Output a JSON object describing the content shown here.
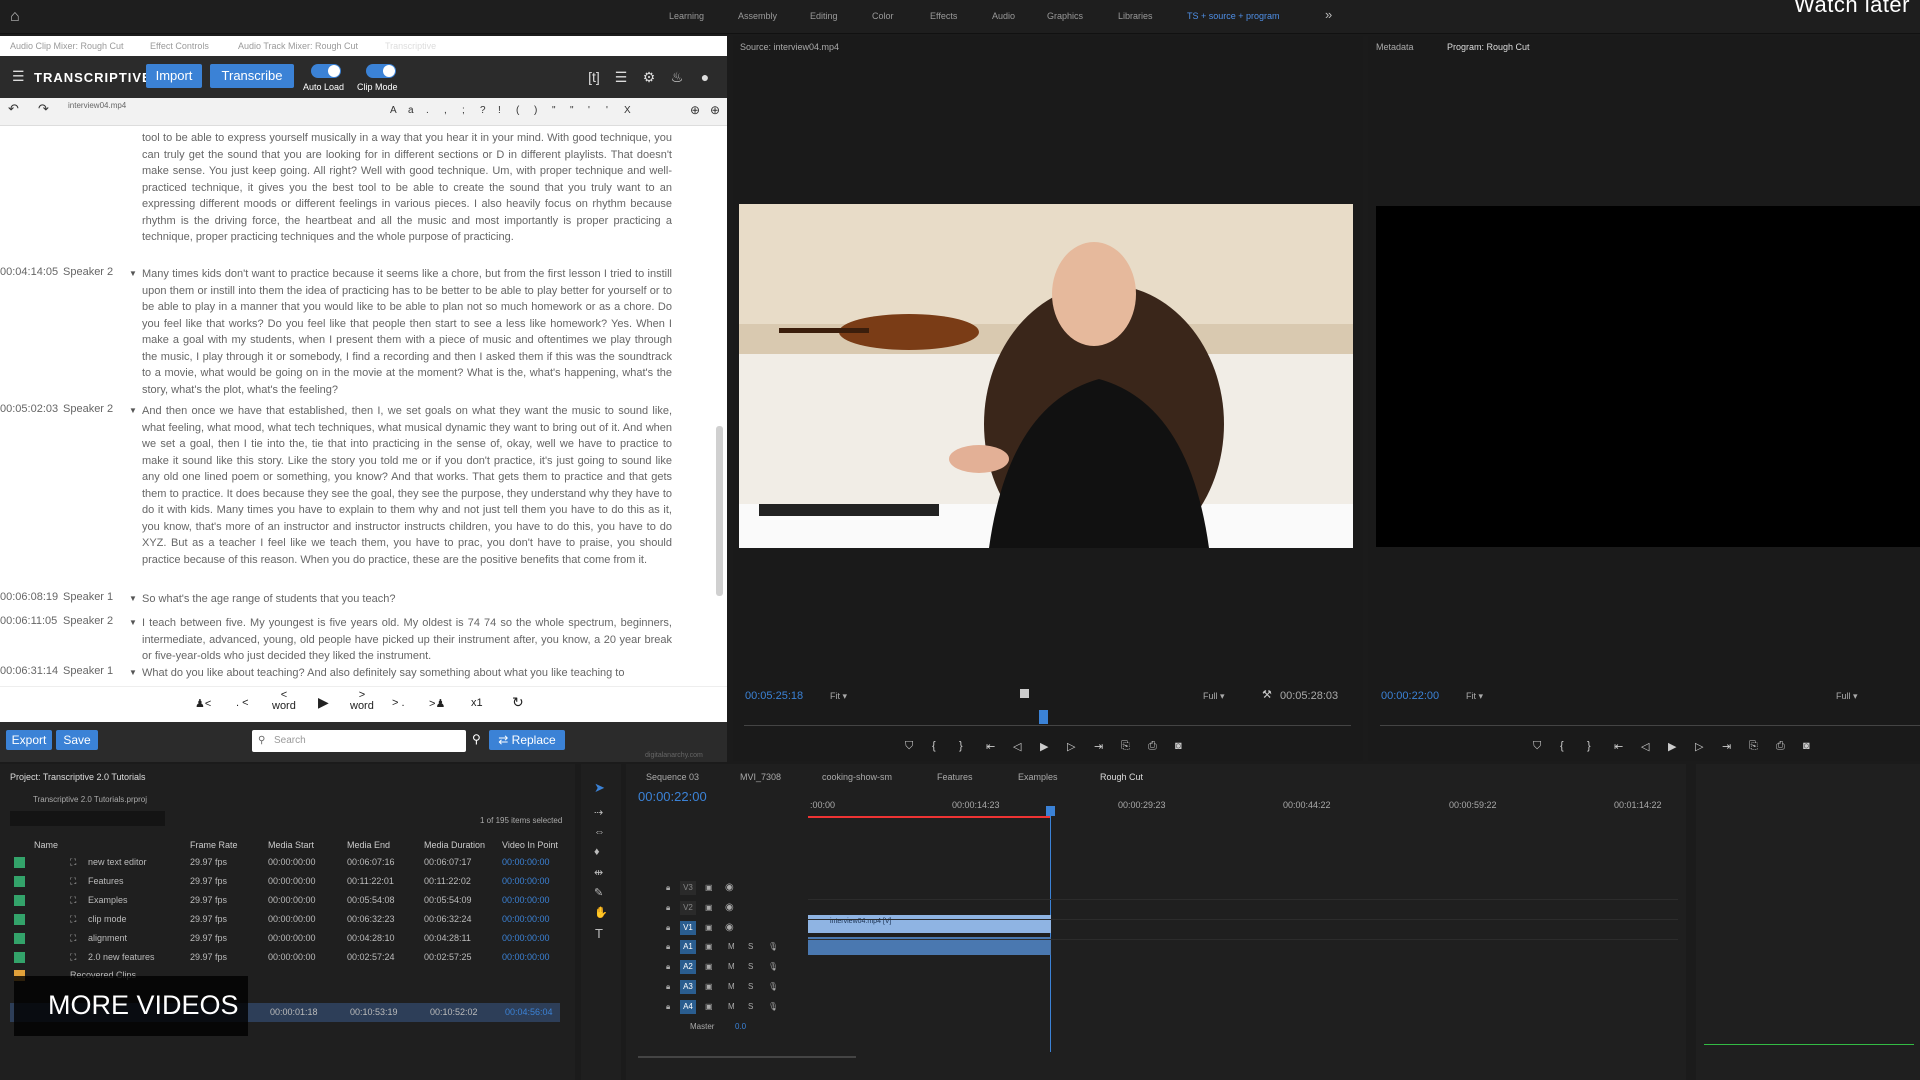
{
  "topbar": {
    "workspaces": [
      "Learning",
      "Assembly",
      "Editing",
      "Color",
      "Effects",
      "Audio",
      "Graphics",
      "Libraries",
      "TS + source + program"
    ],
    "watch_later": "Watch later"
  },
  "left_panel_tabs": [
    "Audio Clip Mixer: Rough Cut",
    "Effect Controls",
    "Audio Track Mixer: Rough Cut",
    "Transcriptive"
  ],
  "transcriptive": {
    "brand": "TRANSCRIPTIVE",
    "import_label": "Import",
    "transcribe_label": "Transcribe",
    "auto_load": "Auto Load",
    "clip_mode": "Clip Mode",
    "file": "interview04.mp4",
    "punct": [
      "A",
      "a",
      ".",
      ",",
      ";",
      "?",
      "!",
      "(",
      ")",
      "\"",
      "\"",
      "'",
      "'",
      "X"
    ],
    "blocks": [
      {
        "time": "",
        "speaker": "",
        "text": "tool to be able to express yourself musically in a way that you hear it in your mind. With good technique, you can truly get the sound that you are looking for in different sections or D in different playlists. That doesn't make sense. You just keep going. All right? Well with good technique. Um, with proper technique and well-practiced technique, it gives you the best tool to be able to create the sound that you truly want to an expressing different moods or different feelings in various pieces. I also heavily focus on rhythm because rhythm is the driving force, the heartbeat and all the music and most importantly is proper practicing a technique, proper practicing techniques and the whole purpose of practicing."
      },
      {
        "time": "00:04:14:05",
        "speaker": "Speaker 2",
        "text": "Many times kids don't want to practice because it seems like a chore, but from the first lesson I tried to instill upon them or instill into them the idea of practicing has to be better to be able to play better for yourself or to be able to play in a manner that you would like to be able to plan not so much homework or as a chore. Do you feel like that works? Do you feel like that people then start to see a less like homework? Yes. When I make a goal with my students, when I present them with a piece of music and oftentimes we play through the music, I play through it or somebody, I find a recording and then I asked them if this was the soundtrack to a movie, what would be going on in the movie at the moment? What is the, what's happening, what's the story, what's the plot, what's the feeling?"
      },
      {
        "time": "00:05:02:03",
        "speaker": "Speaker 2",
        "text": "And then once we have that established, then I, we set goals on what they want the music to sound like, what feeling, what mood, what tech techniques, what musical dynamic they want to bring out of it. And when we set a goal, then I tie into the, tie that into practicing in the sense of, okay, well we have to practice to make it sound like this story. Like the story you told me or if you don't practice, it's just going to sound like any old one lined poem or something, you know? And that works. That gets them to practice and that gets them to practice. It does because they see the goal, they see the purpose, they understand why they have to do it with kids. Many times you have to explain to them why and not just tell them you have to do this as it, you know, that's more of an instructor and instructor instructs children, you have to do this, you have to do XYZ. But as a teacher I feel like we teach them, you have to prac, you don't have to praise, you should practice because of this reason. When you do practice, these are the positive benefits that come from it."
      },
      {
        "time": "00:06:08:19",
        "speaker": "Speaker 1",
        "text": "So what's the age range of students that you teach?"
      },
      {
        "time": "00:06:11:05",
        "speaker": "Speaker 2",
        "text": "I teach between five. My youngest is five years old. My oldest is 74 74 so the whole spectrum, beginners, intermediate, advanced, young, old people have picked up their instrument after, you know, a 20 year break or five-year-olds who just decided they liked the instrument."
      },
      {
        "time": "00:06:31:14",
        "speaker": "Speaker 1",
        "text": "What do you like about teaching? And also definitely say something about what you like teaching to"
      }
    ],
    "nav": {
      "prev_speaker": "<",
      "prev_sent": ". <",
      "prev_word_top": "<",
      "prev_word": "word",
      "next_word_top": ">",
      "next_word": "word",
      "next_sent": "> .",
      "next_speaker": ">",
      "speed": "x1"
    },
    "export_label": "Export",
    "save_label": "Save",
    "search_placeholder": "Search",
    "replace_label": "Replace",
    "footer": "digitalanarchy.com"
  },
  "source": {
    "title": "Source: interview04.mp4",
    "tc_left": "00:05:25:18",
    "fit": "Fit",
    "full": "Full",
    "tc_right": "00:05:28:03"
  },
  "program": {
    "metadata_tab": "Metadata",
    "title": "Program: Rough Cut",
    "tc_left": "00:00:22:00",
    "fit": "Fit",
    "full": "Full"
  },
  "project": {
    "title": "Project: Transcriptive 2.0 Tutorials",
    "file": "Transcriptive 2.0 Tutorials.prproj",
    "count": "1 of 195 items selected",
    "headers": [
      "Name",
      "Frame Rate",
      "Media Start",
      "Media End",
      "Media Duration",
      "Video In Point"
    ],
    "rows": [
      [
        "new text editor",
        "29.97 fps",
        "00:00:00:00",
        "00:06:07:16",
        "00:06:07:17",
        "00:00:00:00"
      ],
      [
        "Features",
        "29.97 fps",
        "00:00:00:00",
        "00:11:22:01",
        "00:11:22:02",
        "00:00:00:00"
      ],
      [
        "Examples",
        "29.97 fps",
        "00:00:00:00",
        "00:05:54:08",
        "00:05:54:09",
        "00:00:00:00"
      ],
      [
        "clip mode",
        "29.97 fps",
        "00:00:00:00",
        "00:06:32:23",
        "00:06:32:24",
        "00:00:00:00"
      ],
      [
        "alignment",
        "29.97 fps",
        "00:00:00:00",
        "00:04:28:10",
        "00:04:28:11",
        "00:00:00:00"
      ],
      [
        "2.0 new features",
        "29.97 fps",
        "00:00:00:00",
        "00:02:57:24",
        "00:02:57:25",
        "00:00:00:00"
      ]
    ],
    "recovered": "Recovered Clips",
    "sel_row": [
      "00:00:01:18",
      "00:10:53:19",
      "00:10:52:02",
      "00:04:56:04"
    ]
  },
  "timeline": {
    "tabs": [
      "Sequence 03",
      "MVI_7308",
      "cooking-show-sm",
      "Features",
      "Examples",
      "Rough Cut"
    ],
    "tc": "00:00:22:00",
    "ruler": [
      ":00:00",
      "00:00:14:23",
      "00:00:29:23",
      "00:00:44:22",
      "00:00:59:22",
      "00:01:14:22"
    ],
    "video_tracks": [
      "V3",
      "V2",
      "V1"
    ],
    "audio_tracks": [
      "A1",
      "A2",
      "A3",
      "A4"
    ],
    "master": "Master",
    "master_val": "0.0",
    "clip": "interview04.mp4 [V]"
  },
  "overlay": {
    "more_videos": "MORE VIDEOS"
  }
}
